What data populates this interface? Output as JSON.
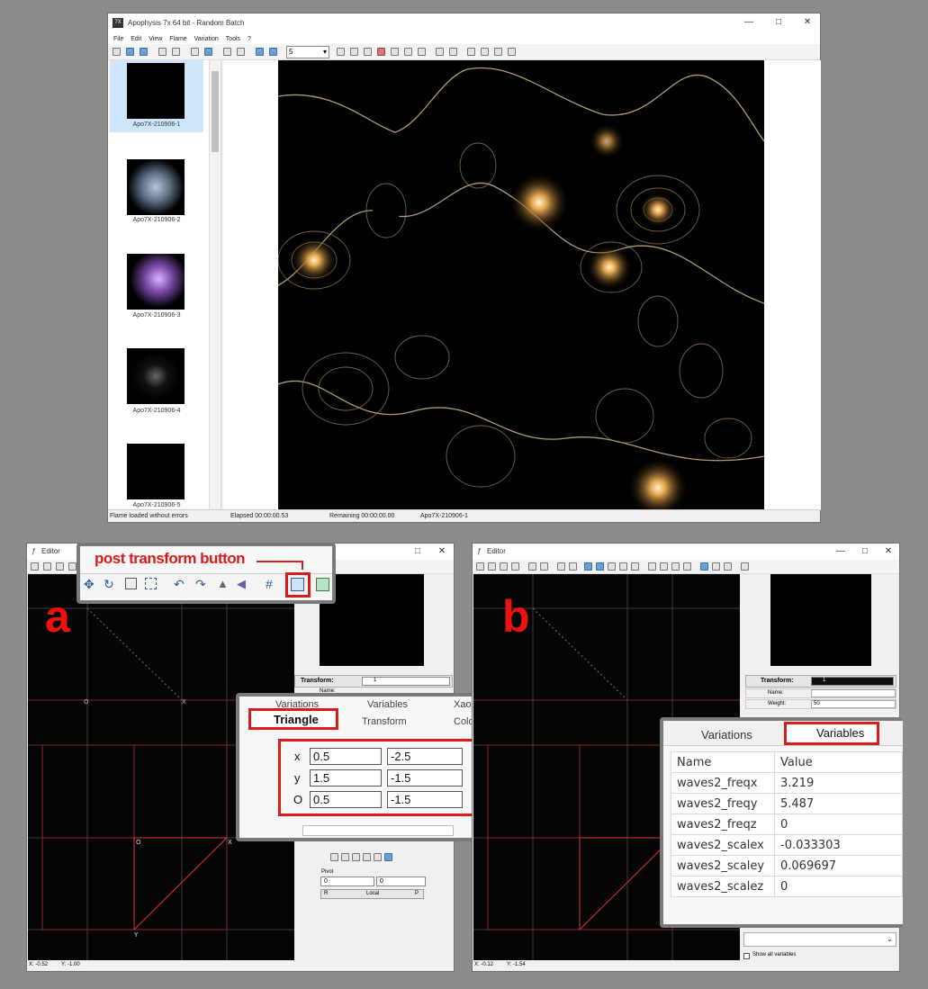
{
  "main_window": {
    "title": "Apophysis 7x 64 bit - Random Batch",
    "menu": [
      "File",
      "Edit",
      "View",
      "Flame",
      "Variation",
      "Tools",
      "?"
    ],
    "quality_value": "5",
    "thumbnails": [
      "Apo7X-210906-1",
      "Apo7X-210906-2",
      "Apo7X-210906-3",
      "Apo7X-210906-4",
      "Apo7X-210906-5"
    ],
    "status": {
      "message": "Flame loaded without errors",
      "elapsed": "Elapsed 00:00:00.53",
      "remaining": "Remaining 00:00:00.00",
      "flame": "Apo7X-210906-1"
    }
  },
  "editor_a": {
    "title": "Editor",
    "panel_label": "a",
    "callout_label": "post transform button",
    "axis_o": "O",
    "axis_x": "X",
    "vertex_o": "O",
    "vertex_x": "X",
    "vertex_y": "Y",
    "transform_label": "Transform:",
    "transform_value": "1",
    "name_label": "Name:",
    "tabs_row1": [
      "Variations",
      "Variables",
      "Xaos"
    ],
    "tabs_row2": [
      "Triangle",
      "Transform",
      "Colors"
    ],
    "triangle": {
      "x": {
        "label": "x",
        "v1": "0.5",
        "v2": "-2.5"
      },
      "y": {
        "label": "y",
        "v1": "1.5",
        "v2": "-1.5"
      },
      "o": {
        "label": "O",
        "v1": "0.5",
        "v2": "-1.5"
      }
    },
    "pivot_label": "Pivot",
    "pivot_x": "0",
    "pivot_y": "0",
    "pivot_left": "R",
    "pivot_mode": "Local",
    "pivot_right": "P",
    "status_x": "X: -0.52",
    "status_y": "Y: -1.00"
  },
  "editor_b": {
    "title": "Editor",
    "panel_label": "b",
    "transform_label": "Transform:",
    "transform_value": "1",
    "name_label": "Name:",
    "weight_label": "Weight:",
    "weight_value": "50",
    "tabs": [
      "Variations",
      "Variables"
    ],
    "table_headers": [
      "Name",
      "Value"
    ],
    "variables": [
      {
        "name": "waves2_freqx",
        "value": "3.219"
      },
      {
        "name": "waves2_freqy",
        "value": "5.487"
      },
      {
        "name": "waves2_freqz",
        "value": "0"
      },
      {
        "name": "waves2_scalex",
        "value": "-0.033303"
      },
      {
        "name": "waves2_scaley",
        "value": "0.069697"
      },
      {
        "name": "waves2_scalez",
        "value": "0"
      }
    ],
    "show_all": "Show all variables",
    "status_x": "X: -0.12",
    "status_y": "Y: -1.54"
  },
  "colors": {
    "accent_red": "#d81b1b",
    "canvas": "#050505",
    "fractal_gold": "#e6c48a"
  }
}
